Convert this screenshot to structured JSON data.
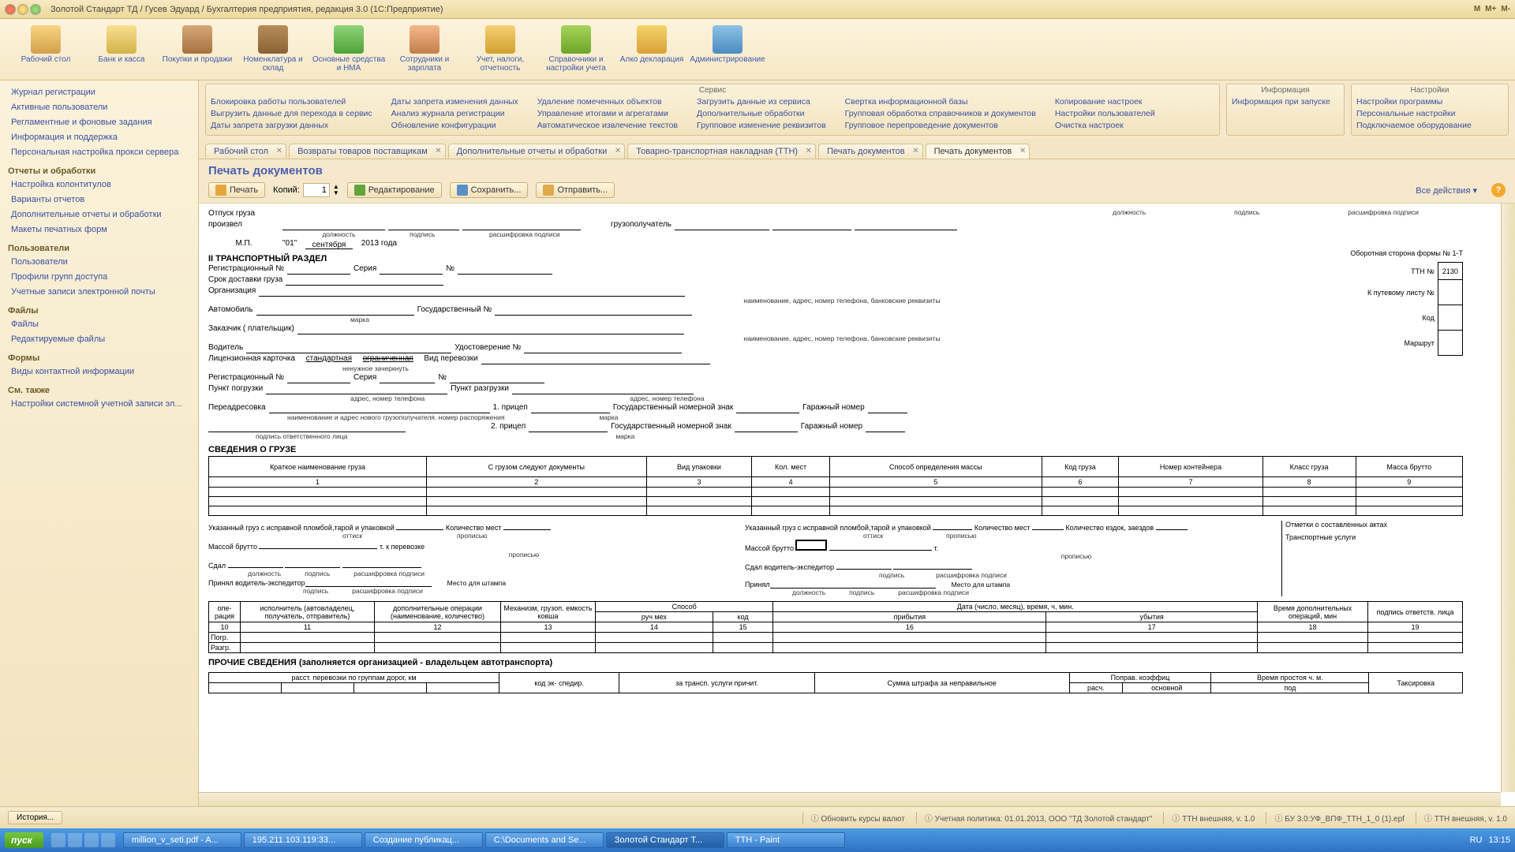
{
  "titlebar": {
    "title": "Золотой Стандарт ТД / Гусев Эдуард / Бухгалтерия предприятия, редакция 3.0  (1С:Предприятие)",
    "m": "M",
    "mplus": "M+",
    "mminus": "M-"
  },
  "maintool": [
    {
      "label": "Рабочий стол"
    },
    {
      "label": "Банк и касса"
    },
    {
      "label": "Покупки и продажи"
    },
    {
      "label": "Номенклатура и склад"
    },
    {
      "label": "Основные средства и НМА"
    },
    {
      "label": "Сотрудники и зарплата"
    },
    {
      "label": "Учет, налоги, отчетность"
    },
    {
      "label": "Справочники и настройки учета"
    },
    {
      "label": "Алко декларация"
    },
    {
      "label": "Администрирование"
    }
  ],
  "leftnav": {
    "items1": [
      "Журнал регистрации",
      "Активные пользователи",
      "Регламентные и фоновые задания",
      "Информация и поддержка",
      "Персональная настройка прокси сервера"
    ],
    "h1": "Отчеты и обработки",
    "items2": [
      "Настройка колонтитулов",
      "Варианты отчетов",
      "Дополнительные отчеты и обработки",
      "Макеты печатных форм"
    ],
    "h2": "Пользователи",
    "items3": [
      "Пользователи",
      "Профили групп доступа",
      "Учетные записи электронной почты"
    ],
    "h3": "Файлы",
    "items4": [
      "Файлы",
      "Редактируемые файлы"
    ],
    "h4": "Формы",
    "items5": [
      "Виды контактной информации"
    ],
    "h5": "См. также",
    "items6": [
      "Настройки системной учетной записи эл..."
    ]
  },
  "service": {
    "title": "Сервис",
    "cols": [
      [
        "Блокировка работы пользователей",
        "Выгрузить данные для перехода в сервис",
        "Даты запрета загрузки данных"
      ],
      [
        "Даты запрета изменения данных",
        "Анализ журнала регистрации",
        "Обновление конфигурации"
      ],
      [
        "Удаление помеченных объектов",
        "Управление итогами и агрегатами",
        "Автоматическое извлечение текстов"
      ],
      [
        "Загрузить данные из сервиса",
        "Дополнительные обработки",
        "Групповое изменение реквизитов"
      ],
      [
        "Свертка информационной базы",
        "Групповая обработка справочников и документов",
        "Групповое перепроведение документов"
      ],
      [
        "Копирование настроек",
        "Настройки пользователей",
        "Очистка настроек"
      ]
    ]
  },
  "info": {
    "title": "Информация",
    "items": [
      "Информация при запуске"
    ]
  },
  "settings": {
    "title": "Настройки",
    "items": [
      "Настройки программы",
      "Персональные настройки",
      "Подключаемое оборудование"
    ]
  },
  "tabs": [
    {
      "label": "Рабочий стол"
    },
    {
      "label": "Возвраты товаров поставщикам"
    },
    {
      "label": "Дополнительные отчеты и обработки"
    },
    {
      "label": "Товарно-транспортная накладная (ТТН)"
    },
    {
      "label": "Печать документов"
    },
    {
      "label": "Печать документов",
      "active": true
    }
  ],
  "doccaption": "Печать документов",
  "doctool": {
    "print": "Печать",
    "copies_label": "Копий:",
    "copies_value": "1",
    "edit": "Редактирование",
    "save": "Сохранить...",
    "send": "Отправить...",
    "all_actions": "Все действия",
    "help": "?"
  },
  "doc": {
    "release": "Отпуск груза произвел",
    "mp": "М.П.",
    "dolzh": "должность",
    "podpis": "подпись",
    "rasshifr": "расшифровка подписи",
    "gruzopol": "грузополучатель",
    "day": "\"01\"",
    "month": "сентября",
    "year": "2013 года",
    "section2": "II ТРАНСПОРТНЫЙ РАЗДЕЛ",
    "oborot": "Оборотная сторона формы № 1-Т",
    "regn": "Регистрационный №",
    "seria": "Серия",
    "num": "№",
    "srok": "Срок доставки груза",
    "org": "Организация",
    "naim_adres": "наименование, адрес, номер телефона, банковские реквизиты",
    "auto": "Автомобиль",
    "marka": "марка",
    "gosn": "Государственный №",
    "customer": "Заказчик ( плательщик)",
    "driver": "Водитель",
    "udost": "Удостоверение №",
    "lic": "Лицензионная карточка",
    "lic_std": "стандартная",
    "lic_ogr": "ограниченная",
    "nenuzh": "ненужное зачеркнуть",
    "vid_per": "Вид перевозки",
    "punkt_p": "Пункт погрузки",
    "punkt_r": "Пункт разгрузки",
    "adres_tel": "адрес, номер телефона",
    "pereadr": "Переадресовка",
    "pereadr_small": "наименование и адрес нового грузополучателя. номер распоряжения",
    "podpis_otv": "подпись ответственного лица",
    "pricep1": "1. прицеп",
    "pricep2": "2. прицеп",
    "gos_nz": "Государственный номерной знак",
    "gar_n": "Гаражный номер",
    "ttn_label": "ТТН №",
    "ttn_value": "2130",
    "kput": "К путевому листу №",
    "kod": "Код",
    "marsh": "Маршрут",
    "cargo_title": "СВЕДЕНИЯ О ГРУЗЕ",
    "cargo_headers": [
      "Краткое наименование груза",
      "С грузом следуют документы",
      "Вид упаковки",
      "Кол. мест",
      "Способ определения массы",
      "Код груза",
      "Номер контейнера",
      "Класс груза",
      "Масса брутто"
    ],
    "cargo_nums": [
      "1",
      "2",
      "3",
      "4",
      "5",
      "6",
      "7",
      "8",
      "9"
    ],
    "ukaz_gruz": "Указанный груз с исправной пломбой,тарой и упаковкой",
    "kol_mest": "Количество мест",
    "kol_ezd": "Количество ездок, заездов",
    "ottisk": "оттиск",
    "propis": "прописью",
    "massa_br": "Массой брутто",
    "tk_per": "т. к перевозке",
    "t": "т.",
    "sdal": "Сдал",
    "sdal_ve": "Сдал водитель-экспедитор",
    "prinyal_ve": "Принял водитель-экспедитор",
    "prinyal": "Принял",
    "otmetki": "Отметки о составленных актах",
    "trusl": "Транспортные услуги",
    "mesto_sht": "Место для штампа",
    "op_headers": [
      "опе-\nрация",
      "исполнитель (автовладелец, получатель, отправитель)",
      "дополнительные операции (наименование, количество)",
      "Механизм, грузоп. емкость ковша",
      "Способ",
      "Дата (число, месяц), время, ч, мин.",
      "Время дополнительных операций, мин",
      "подпись ответств. лица"
    ],
    "op_sub": [
      "руч мех",
      "код",
      "прибытия",
      "убытия"
    ],
    "op_nums": [
      "10",
      "11",
      "12",
      "13",
      "14",
      "15",
      "16",
      "17",
      "18",
      "19"
    ],
    "pogr": "Погр.",
    "razgr": "Разгр.",
    "prochie": "ПРОЧИЕ СВЕДЕНИЯ (заполняется организацией - владельцем автотранспорта)",
    "foot": [
      "расст. перевозки по группам дорог, км",
      "код эк-\nспедир.",
      "за трансп. услуги\nпричит.",
      "Сумма штрафа за\nнеправильное",
      "Поправ. коэффиц",
      "Время простоя ч. м.",
      "Таксировка"
    ],
    "foot_sub": [
      "расч.",
      "основной",
      "под"
    ]
  },
  "statusbar": {
    "history": "История...",
    "right": [
      "Обновить курсы валют",
      "Учетная политика: 01.01.2013, ООО \"ТД Золотой стандарт\"",
      "ТТН внешняя, v. 1.0",
      "БУ 3.0:УФ_ВПФ_ТТН_1_0 (1).epf",
      "ТТН внешняя, v. 1.0"
    ]
  },
  "taskbar": {
    "start": "пуск",
    "tasks": [
      "million_v_seti.pdf - A...",
      "195.211.103.119:33...",
      "Создание публикац...",
      "C:\\Documents and Se...",
      "Золотой Стандарт Т...",
      "ТТН - Paint"
    ],
    "lang": "RU",
    "time": "13:15"
  }
}
